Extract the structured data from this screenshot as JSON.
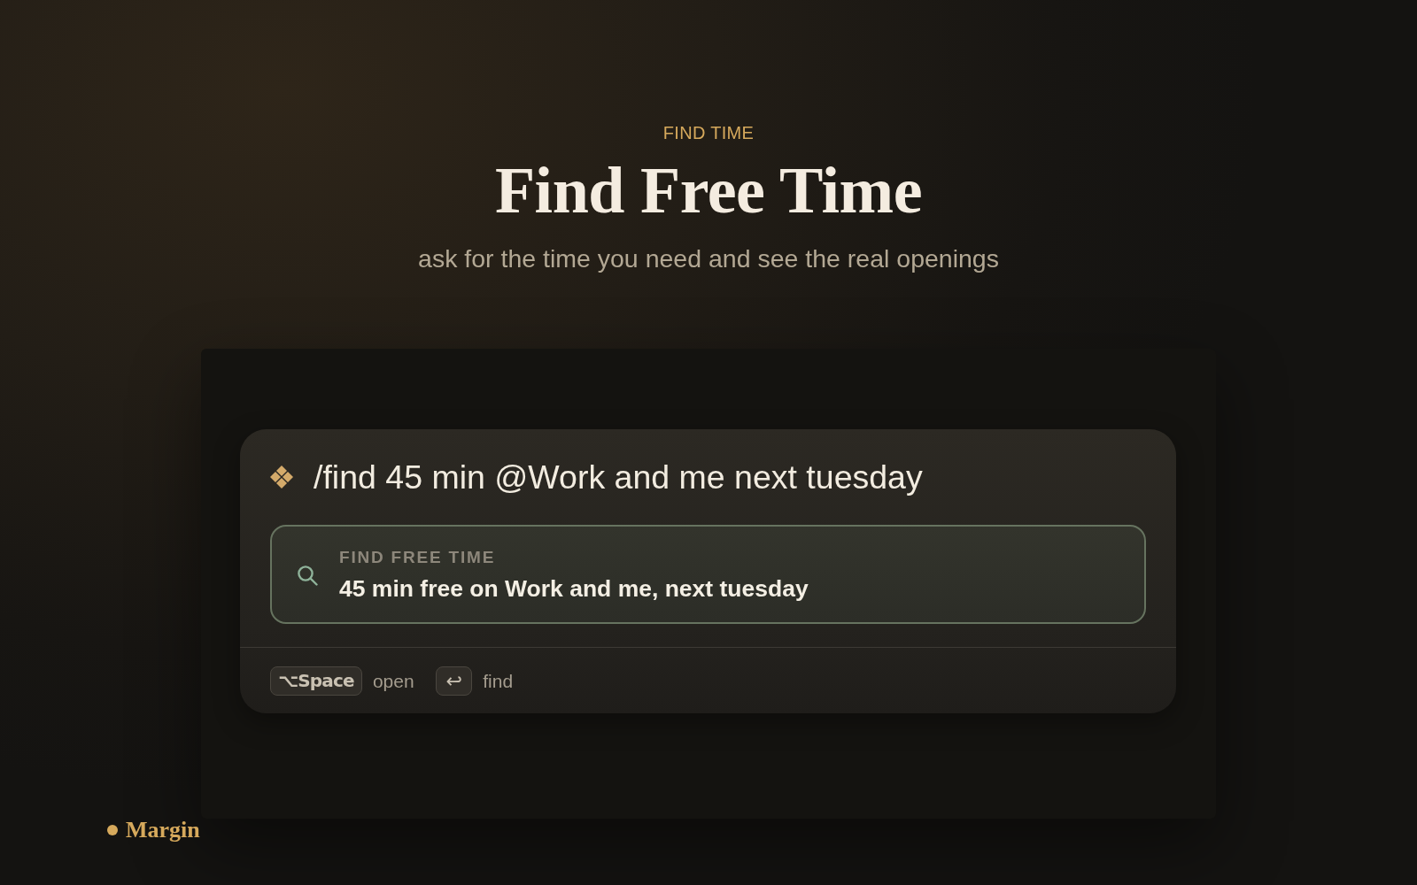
{
  "header": {
    "eyebrow": "FIND TIME",
    "title": "Find Free Time",
    "subtitle": "ask for the time you need and see the real openings"
  },
  "palette": {
    "query": "/find 45 min @Work and me next tuesday",
    "results": [
      {
        "label": "FIND FREE TIME",
        "text": "45 min free on Work and me, next tuesday",
        "selected": true
      }
    ],
    "shortcuts": [
      {
        "key": "⌥Space",
        "action": "open"
      },
      {
        "key": "↩",
        "action": "find"
      }
    ]
  },
  "brand": {
    "name": "Margin"
  }
}
